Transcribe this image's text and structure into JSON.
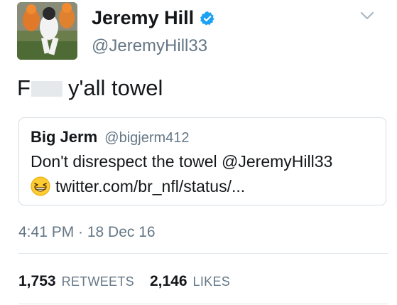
{
  "author": {
    "name": "Jeremy Hill",
    "handle": "@JeremyHill33",
    "verified_icon": "verified-badge-icon",
    "avatar": "avatar-football-player-orange-jersey"
  },
  "tweet": {
    "text_start": "F",
    "text_end": "y'all towel"
  },
  "quoted_tweet": {
    "name": "Big Jerm",
    "handle": "@bigjerm412",
    "line1": "Don't disrespect the towel @JeremyHill33",
    "link": "twitter.com/br_nfl/status/...",
    "emoji_icon": "grinning-squinting-face-emoji"
  },
  "timestamp": "4:41 PM · 18 Dec 16",
  "stats": {
    "retweets_count": "1,753",
    "retweets_label": "RETWEETS",
    "likes_count": "2,146",
    "likes_label": "LIKES"
  },
  "colors": {
    "text": "#14171a",
    "secondary": "#657786",
    "verified": "#1da1f2",
    "border": "#d7dde2"
  }
}
